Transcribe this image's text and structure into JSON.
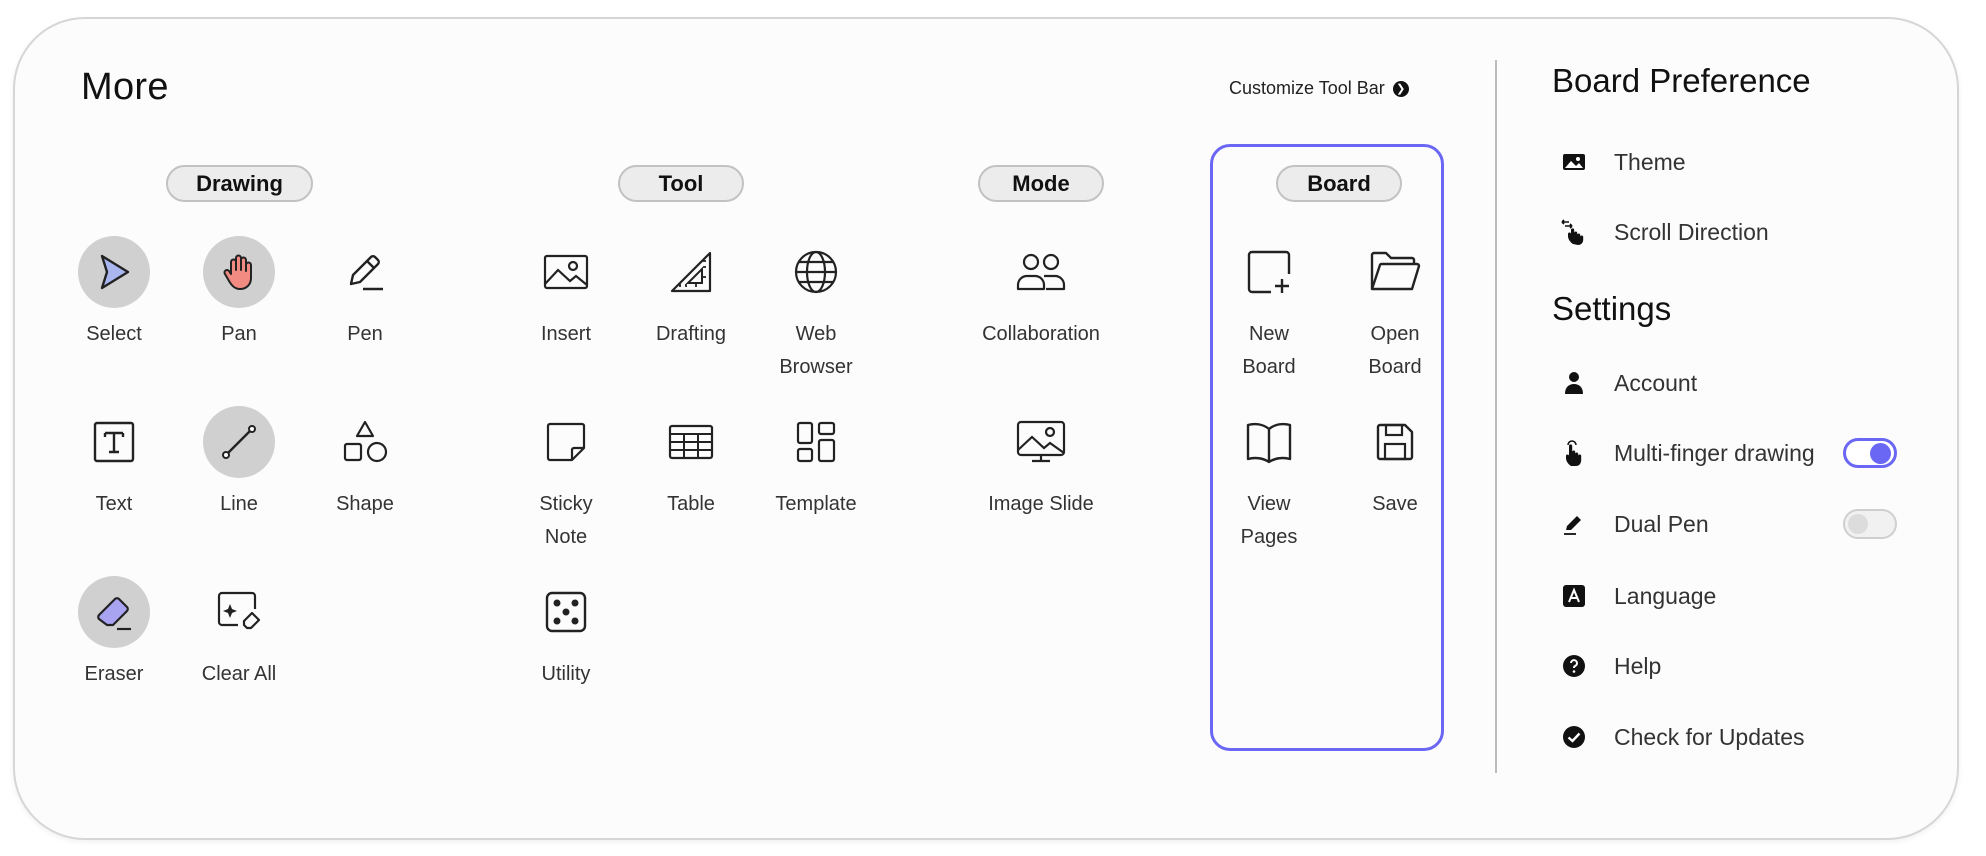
{
  "header": {
    "title": "More",
    "customize_label": "Customize Tool Bar"
  },
  "sections": {
    "drawing": "Drawing",
    "tool": "Tool",
    "mode": "Mode",
    "board": "Board"
  },
  "drawing": {
    "select": "Select",
    "pan": "Pan",
    "pen": "Pen",
    "text": "Text",
    "line": "Line",
    "shape": "Shape",
    "eraser": "Eraser",
    "clear_all": "Clear All"
  },
  "tool": {
    "insert": "Insert",
    "drafting": "Drafting",
    "web_browser": "Web\nBrowser",
    "sticky_note": "Sticky\nNote",
    "table": "Table",
    "template": "Template",
    "utility": "Utility"
  },
  "mode": {
    "collaboration": "Collaboration",
    "image_slide": "Image Slide"
  },
  "board": {
    "new_board": "New\nBoard",
    "open_board": "Open\nBoard",
    "view_pages": "View\nPages",
    "save": "Save"
  },
  "preference": {
    "title": "Board Preference",
    "theme": "Theme",
    "scroll_direction": "Scroll Direction"
  },
  "settings": {
    "title": "Settings",
    "account": "Account",
    "multi_finger": "Multi-finger drawing",
    "multi_finger_on": true,
    "dual_pen": "Dual Pen",
    "dual_pen_on": false,
    "language": "Language",
    "help": "Help",
    "check_updates": "Check for Updates"
  },
  "colors": {
    "accent": "#6a67f5",
    "select_fill": "#a9b6f0",
    "pan_fill": "#f28b82",
    "eraser_fill": "#a9a4f2"
  }
}
